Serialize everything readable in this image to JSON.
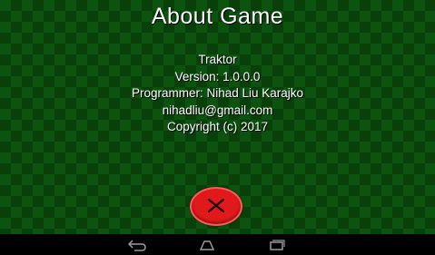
{
  "screen": {
    "title": "About Game",
    "info": [
      "Traktor",
      "Version: 1.0.0.0",
      "Programmer: Nihad Liu Karajko",
      "nihadliu@gmail.com",
      "Copyright (c) 2017"
    ],
    "close_icon": "x-icon"
  },
  "navbar": {
    "back_icon": "back-icon",
    "home_icon": "home-icon",
    "recents_icon": "recent-apps-icon"
  },
  "colors": {
    "background_dark": "#094009",
    "background_light": "#0c5310",
    "close_button": "#e01a1a",
    "text": "#ffffff"
  }
}
